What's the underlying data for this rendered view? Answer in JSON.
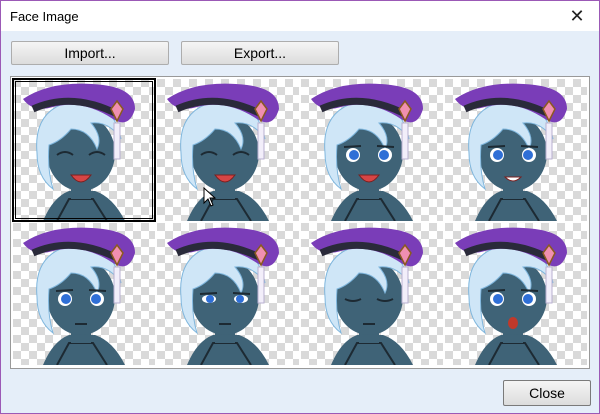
{
  "window": {
    "title": "Face Image"
  },
  "toolbar": {
    "import_label": "Import...",
    "export_label": "Export..."
  },
  "footer": {
    "close_label": "Close"
  },
  "faces": [
    {
      "expression": "eyes-closed-smile",
      "selected": true
    },
    {
      "expression": "eyes-closed-smile",
      "selected": false
    },
    {
      "expression": "open-smile",
      "selected": false
    },
    {
      "expression": "happy",
      "selected": false
    },
    {
      "expression": "neutral",
      "selected": false
    },
    {
      "expression": "serious",
      "selected": false
    },
    {
      "expression": "eyes-closed",
      "selected": false
    },
    {
      "expression": "surprised",
      "selected": false
    }
  ],
  "colors": {
    "accent": "#9b59b6",
    "hat": "#7a3db8",
    "skin": "#3f6377",
    "hair": "#cfe6f7"
  }
}
